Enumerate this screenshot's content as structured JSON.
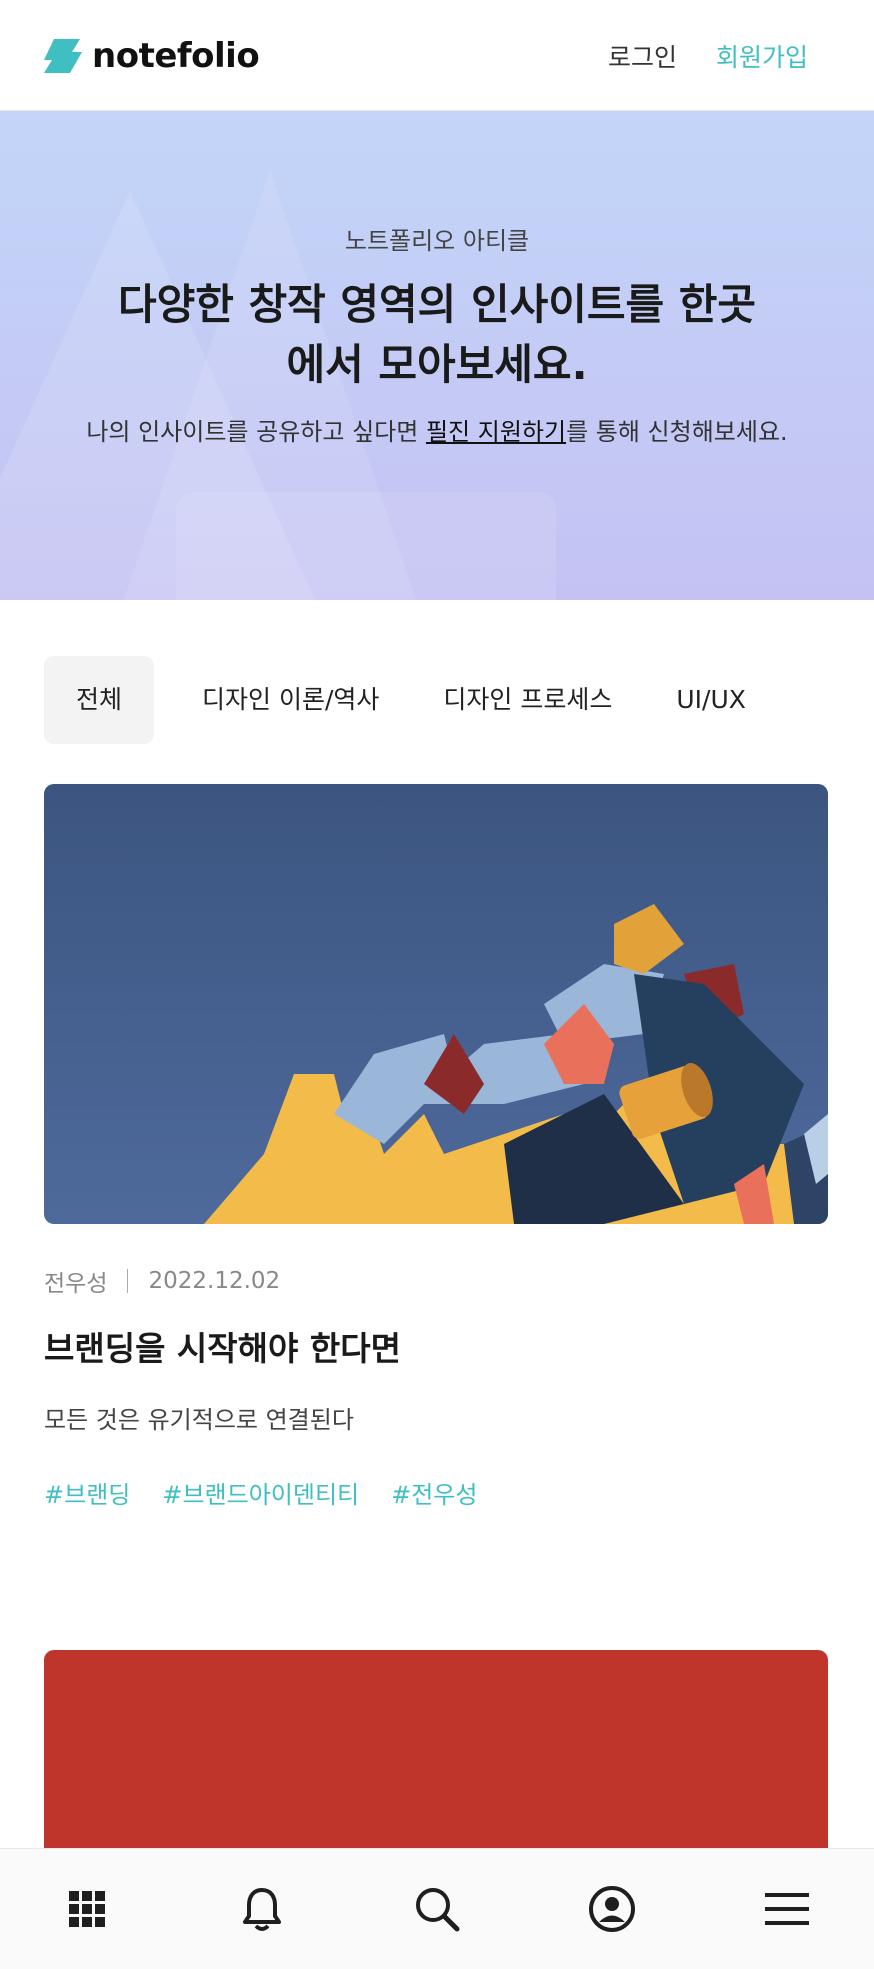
{
  "header": {
    "logo_text": "notefolio",
    "login_label": "로그인",
    "signup_label": "회원가입"
  },
  "hero": {
    "kicker": "노트폴리오 아티클",
    "title_line1": "다양한 창작 영역의 인사이트를 한곳",
    "title_line2": "에서 모아보세요.",
    "desc_before": "나의 인사이트를 공유하고 싶다면 ",
    "desc_link": "필진 지원하기",
    "desc_after": "를 통해 신청해보세요."
  },
  "tabs": [
    {
      "label": "전체",
      "active": true
    },
    {
      "label": "디자인 이론/역사",
      "active": false
    },
    {
      "label": "디자인 프로세스",
      "active": false
    },
    {
      "label": "UI/UX",
      "active": false
    }
  ],
  "articles": [
    {
      "author": "전우성",
      "date": "2022.12.02",
      "title": "브랜딩을 시작해야 한다면",
      "subtitle": "모든 것은 유기적으로 연결된다",
      "tags": [
        "#브랜딩",
        "#브랜드아이덴티티",
        "#전우성"
      ]
    }
  ],
  "colors": {
    "accent": "#3fbfc2",
    "hero_top": "#c3d5f8",
    "hero_bottom": "#c4c2f3",
    "card2_red": "#c0352b"
  },
  "bottom_nav": {
    "icons": [
      "grid-icon",
      "bell-icon",
      "search-icon",
      "profile-icon",
      "menu-icon"
    ]
  }
}
